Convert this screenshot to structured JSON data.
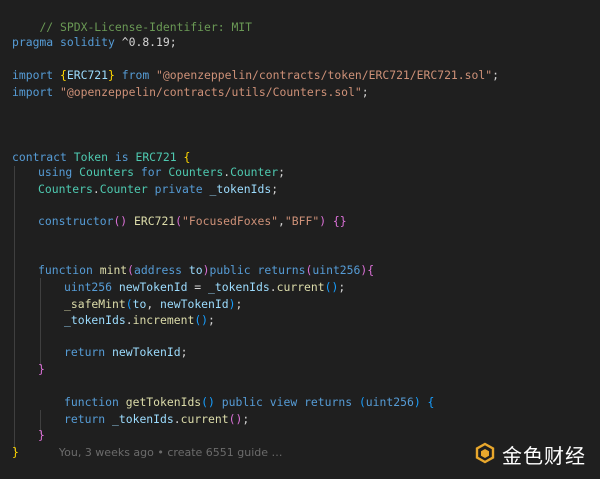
{
  "editor": {
    "lines": {
      "l1": {
        "comment": "// SPDX-License-Identifier: MIT"
      },
      "l2": {
        "kw": "pragma",
        "sp": " ",
        "kw2": "solidity",
        "rest": " ^0.8.19;"
      },
      "l3": {
        "kw": "import",
        "open": " {",
        "name": "ERC721",
        "close": "}",
        "from": " from ",
        "path": "\"@openzeppelin/contracts/token/ERC721/ERC721.sol\"",
        "semi": ";"
      },
      "l4": {
        "kw": "import",
        "sp": " ",
        "path": "\"@openzeppelin/contracts/utils/Counters.sol\"",
        "semi": ";"
      },
      "l5": {
        "kw": "contract",
        "sp": " ",
        "name": "Token",
        "is": " is ",
        "base": "ERC721",
        "brace": " {"
      },
      "l6": {
        "kw": "using",
        "sp": " ",
        "lib": "Counters",
        "for": " for ",
        "lib2": "Counters",
        "dot": ".",
        "type": "Counter",
        "semi": ";"
      },
      "l7": {
        "lib": "Counters",
        "dot": ".",
        "type": "Counter",
        "kw": " private ",
        "var": "_tokenIds",
        "semi": ";"
      },
      "l8": {
        "kw": "constructor",
        "paren": "() ",
        "fn": "ERC721",
        "open": "(",
        "s1": "\"FocusedFoxes\"",
        "comma": ",",
        "s2": "\"BFF\"",
        "close": ") ",
        "braces": "{}"
      },
      "l9": {
        "kw": "function",
        "sp": " ",
        "fn": "mint",
        "open": "(",
        "type": "address",
        "sp2": " ",
        "var": "to",
        "close": ")",
        "kw2": "public",
        "sp3": " ",
        "kw3": "returns",
        "open2": "(",
        "type2": "uint256",
        "close2": ")",
        "brace": "{"
      },
      "l10": {
        "type": "uint256",
        "sp": " ",
        "var": "newTokenId",
        "eq": " = ",
        "var2": "_tokenIds",
        "dot": ".",
        "fn": "current",
        "call": "()",
        "semi": ";"
      },
      "l11": {
        "fn": "_safeMint",
        "open": "(",
        "var": "to",
        "comma": ", ",
        "var2": "newTokenId",
        "close": ")",
        "semi": ";"
      },
      "l12": {
        "var": "_tokenIds",
        "dot": ".",
        "fn": "increment",
        "call": "()",
        "semi": ";"
      },
      "l13": {
        "kw": "return",
        "sp": " ",
        "var": "newTokenId",
        "semi": ";"
      },
      "l14": {
        "brace": "}"
      },
      "l15": {
        "kw": "function",
        "sp": " ",
        "fn": "getTokenIds",
        "paren": "() ",
        "kw2": "public",
        "sp2": " ",
        "kw3": "view",
        "sp3": " ",
        "kw4": "returns",
        "sp4": " ",
        "open": "(",
        "type": "uint256",
        "close": ")",
        "brace": " {"
      },
      "l16": {
        "kw": "return",
        "sp": " ",
        "var": "_tokenIds",
        "dot": ".",
        "fn": "current",
        "call": "()",
        "semi": ";"
      },
      "l17": {
        "brace": "}"
      },
      "l18": {
        "brace": "}",
        "blame": "You, 3 weeks ago • create 6551 guide …"
      }
    }
  },
  "watermark": {
    "text": "金色财经",
    "icon": "jinse-logo-icon",
    "color": "#e8a72c"
  }
}
